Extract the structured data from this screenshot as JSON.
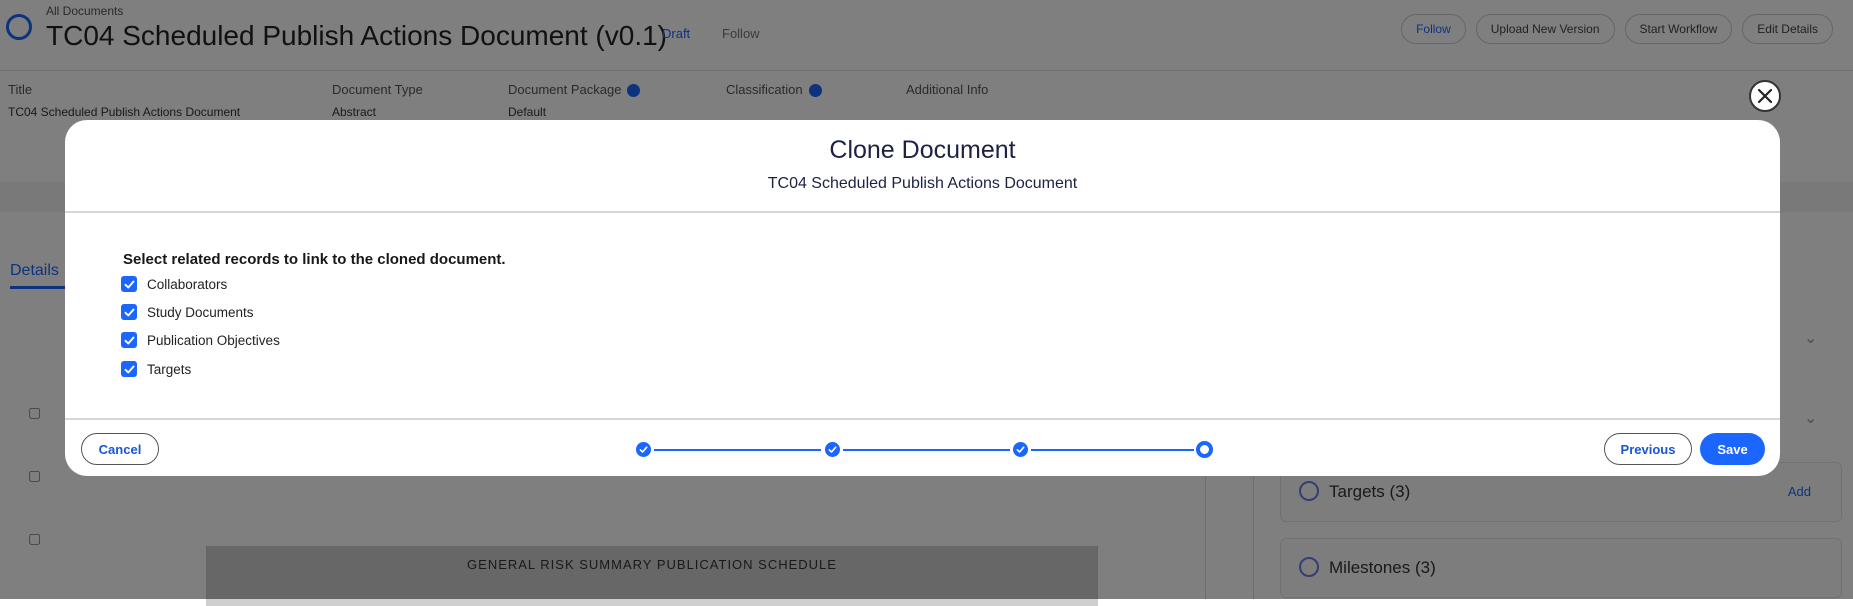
{
  "background": {
    "breadcrumb": "All Documents",
    "title": "TC04 Scheduled Publish Actions Document (v0.1)",
    "badge": "Draft",
    "follow": "Follow",
    "actions": [
      "Follow",
      "Upload New Version",
      "Start Workflow",
      "Edit Details"
    ],
    "fields": [
      {
        "label": "Title",
        "value": "TC04 Scheduled Publish Actions Document"
      },
      {
        "label": "Document Type",
        "value": "Abstract"
      },
      {
        "label": "Document Package",
        "value": "Default"
      },
      {
        "label": "Classification",
        "value": ""
      },
      {
        "label": "Additional Info",
        "value": ""
      }
    ],
    "tab": "Details",
    "doc_banner": "GENERAL RISK SUMMARY PUBLICATION SCHEDULE",
    "right_items": [
      {
        "label": "Targets (3)",
        "action": "Add"
      },
      {
        "label": "Milestones (3)",
        "action": ""
      }
    ]
  },
  "modal": {
    "title": "Clone Document",
    "subtitle": "TC04 Scheduled Publish Actions Document",
    "instruction": "Select related records to link to the cloned document.",
    "options": [
      {
        "label": "Collaborators",
        "checked": true
      },
      {
        "label": "Study Documents",
        "checked": true
      },
      {
        "label": "Publication Objectives",
        "checked": true
      },
      {
        "label": "Targets",
        "checked": true
      }
    ],
    "footer": {
      "cancel_label": "Cancel",
      "previous_label": "Previous",
      "save_label": "Save"
    },
    "stepper": {
      "total_steps": 4,
      "current_step": 4
    }
  },
  "colors": {
    "accent": "#1a66ff",
    "heading": "#1b2244"
  },
  "icons": {
    "close": "close-icon",
    "check": "check-icon"
  }
}
